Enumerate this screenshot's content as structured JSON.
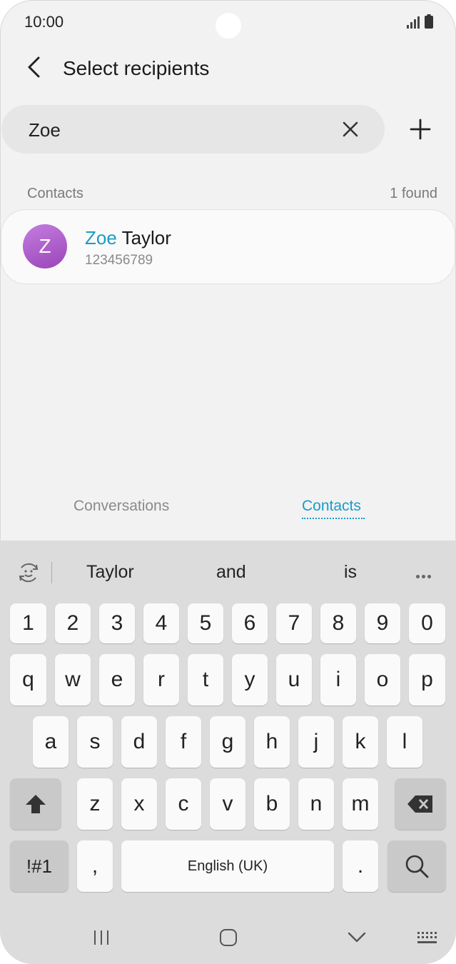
{
  "status": {
    "time": "10:00"
  },
  "header": {
    "title": "Select recipients"
  },
  "search": {
    "value": "Zoe"
  },
  "contacts_section": {
    "label": "Contacts",
    "count": "1 found"
  },
  "contact": {
    "avatar_letter": "Z",
    "name_highlight": "Zoe",
    "name_rest": " Taylor",
    "number": "123456789"
  },
  "tabs": [
    {
      "label": "Conversations",
      "active": false
    },
    {
      "label": "Contacts",
      "active": true
    }
  ],
  "keyboard": {
    "suggestions": [
      "Taylor",
      "and",
      "is"
    ],
    "number_row": [
      "1",
      "2",
      "3",
      "4",
      "5",
      "6",
      "7",
      "8",
      "9",
      "0"
    ],
    "row1": [
      "q",
      "w",
      "e",
      "r",
      "t",
      "y",
      "u",
      "i",
      "o",
      "p"
    ],
    "row2": [
      "a",
      "s",
      "d",
      "f",
      "g",
      "h",
      "j",
      "k",
      "l"
    ],
    "row3": [
      "z",
      "x",
      "c",
      "v",
      "b",
      "n",
      "m"
    ],
    "symbols_label": "!#1",
    "comma": ",",
    "space_label": "English (UK)",
    "period": "."
  },
  "colors": {
    "accent": "#1a9cc7",
    "avatar": "#b060d0",
    "background": "#f2f2f2",
    "keyboard": "#dcdcdc"
  }
}
